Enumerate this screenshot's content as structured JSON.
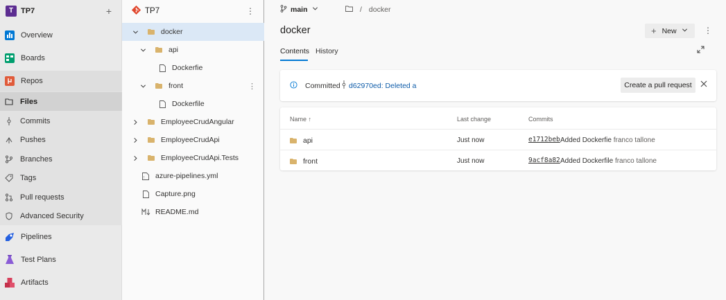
{
  "project": {
    "initial": "T",
    "name": "TP7"
  },
  "nav": {
    "overview": "Overview",
    "boards": "Boards",
    "repos": "Repos",
    "files": "Files",
    "commits": "Commits",
    "pushes": "Pushes",
    "branches": "Branches",
    "tags": "Tags",
    "pull_requests": "Pull requests",
    "advanced_security": "Advanced Security",
    "pipelines": "Pipelines",
    "test_plans": "Test Plans",
    "artifacts": "Artifacts"
  },
  "tree": {
    "repo_name": "TP7",
    "items": [
      {
        "label": "docker",
        "type": "folder",
        "expanded": true,
        "selected": true
      },
      {
        "label": "api",
        "type": "folder",
        "expanded": true
      },
      {
        "label": "Dockerfie",
        "type": "file"
      },
      {
        "label": "front",
        "type": "folder",
        "expanded": true
      },
      {
        "label": "Dockerfile",
        "type": "file"
      },
      {
        "label": "EmployeeCrudAngular",
        "type": "folder",
        "expanded": false
      },
      {
        "label": "EmployeeCrudApi",
        "type": "folder",
        "expanded": false
      },
      {
        "label": "EmployeeCrudApi.Tests",
        "type": "folder",
        "expanded": false
      },
      {
        "label": "azure-pipelines.yml",
        "type": "yaml"
      },
      {
        "label": "Capture.png",
        "type": "file"
      },
      {
        "label": "README.md",
        "type": "markdown"
      }
    ]
  },
  "main": {
    "branch": "main",
    "breadcrumb_sep": "/",
    "breadcrumb_folder": "docker",
    "title": "docker",
    "new_label": "New",
    "tabs": [
      "Contents",
      "History"
    ],
    "commit_banner": {
      "label": "Committed",
      "commit_text": "d62970ed: Deleted a",
      "pr_button": "Create a pull request"
    },
    "table": {
      "headers": {
        "name": "Name ↑",
        "last_change": "Last change",
        "commits": "Commits"
      },
      "rows": [
        {
          "name": "api",
          "last_change": "Just now",
          "hash": "e1712beb",
          "message": "Added Dockerfie",
          "author": "franco tallone"
        },
        {
          "name": "front",
          "last_change": "Just now",
          "hash": "9acf8a82",
          "message": "Added Dockerfile",
          "author": "franco tallone"
        }
      ]
    }
  },
  "colors": {
    "accent": "#0078d4",
    "folder": "#d9b36c",
    "repos_icon": "#e05b3a",
    "project_avatar": "#5c2d91"
  }
}
